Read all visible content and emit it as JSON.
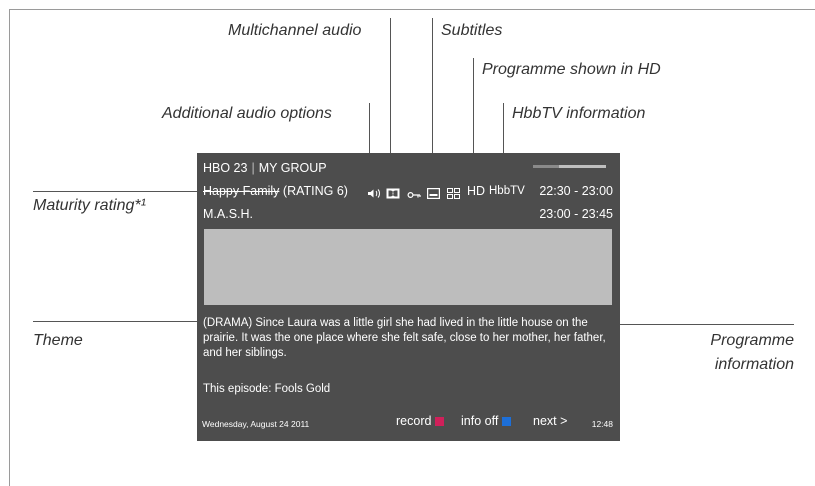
{
  "callouts": {
    "multichannel_audio": "Multichannel audio",
    "subtitles": "Subtitles",
    "programme_hd": "Programme shown in HD",
    "additional_audio": "Additional audio options",
    "hbbtv_info": "HbbTV information",
    "maturity_rating": "Maturity rating*¹",
    "theme": "Theme",
    "programme_information_line1": "Programme",
    "programme_information_line2": "information"
  },
  "tv": {
    "channel": "HBO 23",
    "separator": "|",
    "group": "MY GROUP",
    "progress_fraction": 0.35,
    "current_title": "Happy Family",
    "current_rating": "(RATING 6)",
    "hd_label": "HD",
    "hbbtv_label": "HbbTV",
    "current_time": "22:30 - 23:00",
    "next_title": "M.A.S.H.",
    "next_time": "23:00 - 23:45",
    "description": "(DRAMA) Since Laura was a little girl she had lived in the little house on the prairie. It was the one place where she felt safe, close to her mother, her father, and her siblings.",
    "episode": "This episode: Fools Gold",
    "date": "Wednesday, August 24 2011",
    "record_label": "record",
    "info_off_label": "info off",
    "next_label": "next",
    "next_arrow": ">",
    "clock": "12:48",
    "icons": [
      "speaker-icon",
      "dolby-icon",
      "key-icon",
      "subtitles-icon",
      "hbbtv-grid-icon"
    ],
    "colors": {
      "background": "#4d4d4d",
      "record": "#d0205a",
      "info_off": "#1d6fd8",
      "panel": "#bdbdbd"
    }
  }
}
